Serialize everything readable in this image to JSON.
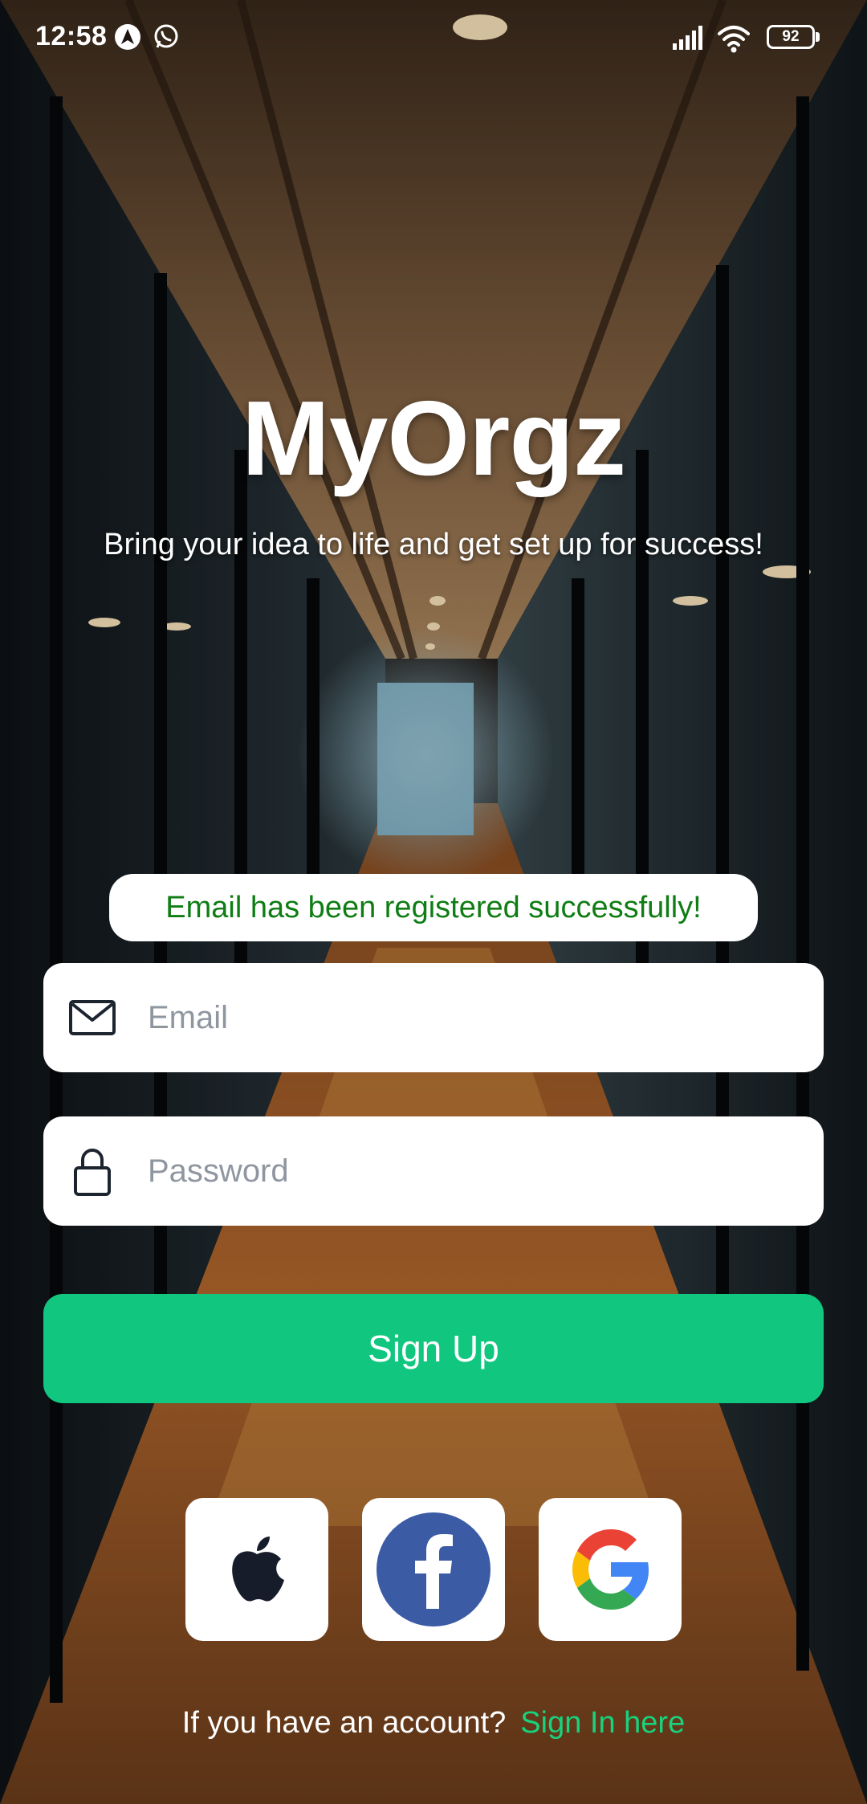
{
  "status_bar": {
    "time": "12:58",
    "battery": "92"
  },
  "hero": {
    "title": "MyOrgz",
    "tagline": "Bring your idea to life and get set up for success!"
  },
  "toast": {
    "message": "Email has been registered successfully!",
    "color": "#0f7d14"
  },
  "form": {
    "email_placeholder": "Email",
    "email_value": "",
    "password_placeholder": "Password",
    "password_value": "",
    "submit_label": "Sign Up",
    "submit_color": "#11c77f"
  },
  "social": {
    "items": [
      {
        "name": "apple",
        "icon": "apple-icon"
      },
      {
        "name": "facebook",
        "icon": "facebook-icon",
        "color": "#3b5ba5"
      },
      {
        "name": "google",
        "icon": "google-icon"
      }
    ]
  },
  "footer": {
    "prompt": "If you have an account?",
    "link": "Sign In here",
    "link_color": "#18d27e"
  }
}
